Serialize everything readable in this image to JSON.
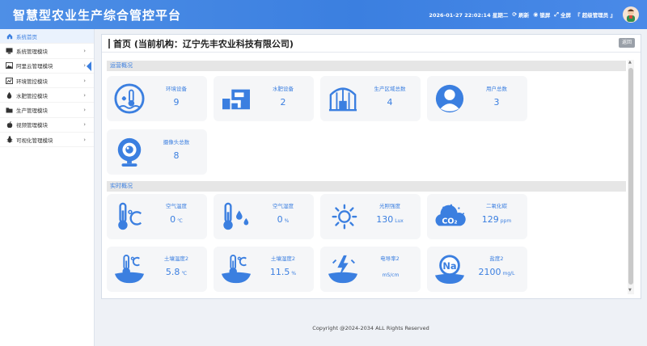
{
  "header": {
    "title": "智慧型农业生产综合管控平台",
    "datetime": "2026-01-27 22:02:14 星期二",
    "refresh_label": "刷新",
    "lock_label": "锁屏",
    "fullscreen_label": "全屏",
    "user_label": "『 超级管理员 』",
    "colors": {
      "header_bg": "#3b7fe0",
      "accent": "#3b7fe0"
    }
  },
  "sidebar": {
    "items": [
      {
        "label": "系统首页",
        "icon": "home-icon"
      },
      {
        "label": "系统管理模块",
        "icon": "monitor-icon"
      },
      {
        "label": "阿里云管理模块",
        "icon": "image-icon"
      },
      {
        "label": "环境管控模块",
        "icon": "chart-icon"
      },
      {
        "label": "水肥管控模块",
        "icon": "water-icon"
      },
      {
        "label": "生产管理模块",
        "icon": "folder-icon"
      },
      {
        "label": "视频管理模块",
        "icon": "apple-icon"
      },
      {
        "label": "可视化管理模块",
        "icon": "bug-icon"
      }
    ]
  },
  "main": {
    "page_title": "首页 (当前机构：辽宁先丰农业科技有限公司)",
    "back_label": "返回",
    "ops": {
      "section_title": "运营概况",
      "cards": [
        {
          "label": "环境设备",
          "value": "9",
          "icon": "water-temperature-icon"
        },
        {
          "label": "水肥设备",
          "value": "2",
          "icon": "water-fertilizer-device-icon"
        },
        {
          "label": "生产区域总数",
          "value": "4",
          "icon": "greenhouse-icon"
        },
        {
          "label": "用户总数",
          "value": "3",
          "icon": "user-icon"
        },
        {
          "label": "摄像头总数",
          "value": "8",
          "icon": "camera-icon"
        }
      ]
    },
    "realtime": {
      "section_title": "实时概况",
      "cards": [
        {
          "label": "空气温度",
          "value": "0",
          "unit": "℃",
          "icon": "air-temperature-icon"
        },
        {
          "label": "空气湿度",
          "value": "0",
          "unit": "%",
          "icon": "air-humidity-icon"
        },
        {
          "label": "光照强度",
          "value": "130",
          "unit": "Lux",
          "icon": "sun-icon"
        },
        {
          "label": "二氧化碳",
          "value": "129",
          "unit": "ppm",
          "icon": "co2-icon"
        },
        {
          "label": "土壤温度2",
          "value": "5.8",
          "unit": "℃",
          "icon": "soil-temperature-icon"
        },
        {
          "label": "土壤湿度2",
          "value": "11.5",
          "unit": "%",
          "icon": "soil-humidity-icon"
        },
        {
          "label": "电导率2",
          "value": "",
          "unit": "mS/cm",
          "icon": "conductivity-icon"
        },
        {
          "label": "盐度2",
          "value": "2100",
          "unit": "mg/L",
          "icon": "salinity-icon"
        }
      ]
    }
  },
  "footer": {
    "copyright": "Copyright @2024-2034 ALL Rights Reserved"
  }
}
